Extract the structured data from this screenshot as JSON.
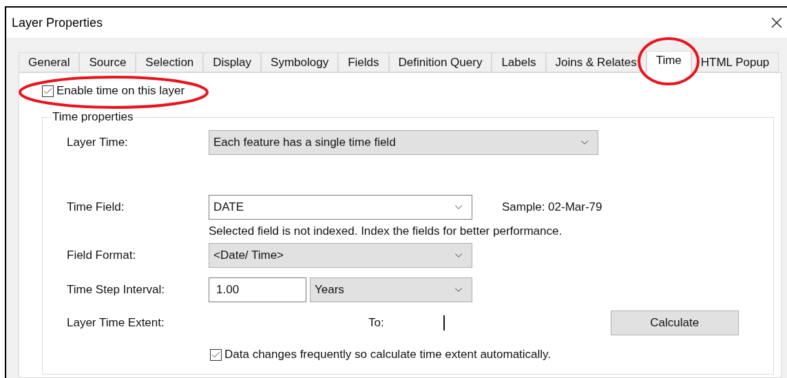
{
  "window": {
    "title": "Layer Properties"
  },
  "tabs": [
    {
      "label": "General",
      "selected": false
    },
    {
      "label": "Source",
      "selected": false
    },
    {
      "label": "Selection",
      "selected": false
    },
    {
      "label": "Display",
      "selected": false
    },
    {
      "label": "Symbology",
      "selected": false
    },
    {
      "label": "Fields",
      "selected": false
    },
    {
      "label": "Definition Query",
      "selected": false
    },
    {
      "label": "Labels",
      "selected": false
    },
    {
      "label": "Joins & Relates",
      "selected": false
    },
    {
      "label": "Time",
      "selected": true
    },
    {
      "label": "HTML Popup",
      "selected": false
    }
  ],
  "enable_time": {
    "label": "Enable time on this layer",
    "checked": true
  },
  "time_properties": {
    "title": "Time properties",
    "layer_time": {
      "label": "Layer Time:",
      "value": "Each feature has a single time field"
    },
    "time_field": {
      "label": "Time Field:",
      "value": "DATE",
      "sample": "Sample: 02-Mar-79"
    },
    "message": "Selected field is not indexed. Index the fields for better performance.",
    "field_format": {
      "label": "Field Format:",
      "value": "<Date/ Time>"
    },
    "time_step_interval": {
      "label": "Time Step Interval:",
      "value": "1.00",
      "unit": "Years"
    },
    "layer_time_extent": {
      "label": "Layer Time Extent:",
      "to_label": "To:",
      "button": "Calculate"
    },
    "auto_calculate": {
      "label": "Data changes frequently so calculate time extent automatically.",
      "checked": true
    }
  }
}
